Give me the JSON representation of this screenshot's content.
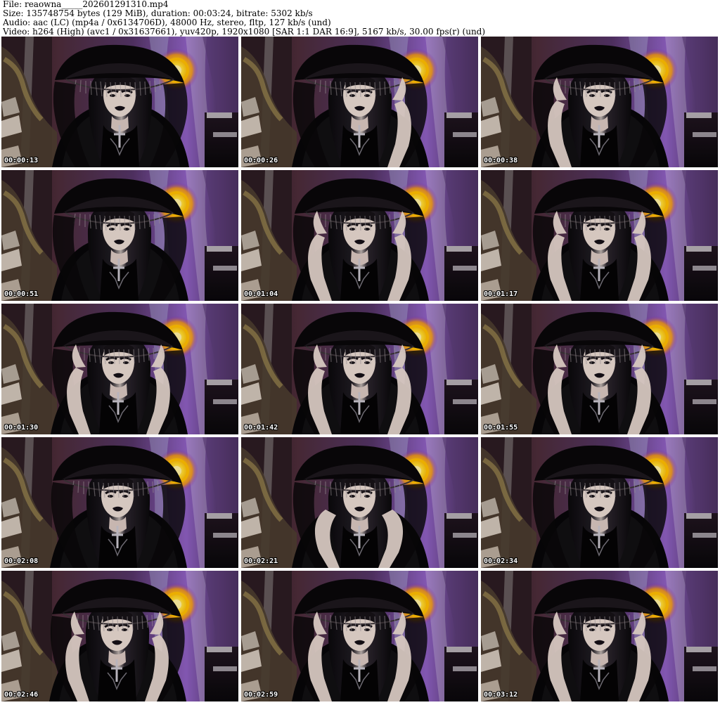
{
  "header": {
    "file_line": "File: reaowna_____202601291310.mp4",
    "size_line": "Size: 135748754 bytes (129 MiB), duration: 00:03:24, bitrate: 5302 kb/s",
    "audio_line": "Audio: aac (LC) (mp4a / 0x6134706D), 48000 Hz, stereo, fltp, 127 kb/s (und)",
    "video_line": "Video: h264 (High) (avc1 / 0x31637661), yuv420p, 1920x1080 [SAR 1:1 DAR 16:9], 5167 kb/s, 30.00 fps(r) (und)"
  },
  "thumbnails": [
    {
      "time": "00:00:13",
      "pose": "hat"
    },
    {
      "time": "00:00:26",
      "pose": "hand-right-hat"
    },
    {
      "time": "00:00:38",
      "pose": "hand-left-up"
    },
    {
      "time": "00:00:51",
      "pose": "hat"
    },
    {
      "time": "00:01:04",
      "pose": "hands-both-hat"
    },
    {
      "time": "00:01:17",
      "pose": "hands-both-side"
    },
    {
      "time": "00:01:30",
      "pose": "hands-both-hat"
    },
    {
      "time": "00:01:42",
      "pose": "hands-both-hat"
    },
    {
      "time": "00:01:55",
      "pose": "hands-both-hat"
    },
    {
      "time": "00:02:08",
      "pose": "hat"
    },
    {
      "time": "00:02:21",
      "pose": "hands-hair"
    },
    {
      "time": "00:02:34",
      "pose": "hat"
    },
    {
      "time": "00:02:46",
      "pose": "hands-both-hat"
    },
    {
      "time": "00:02:59",
      "pose": "hands-both-hat"
    },
    {
      "time": "00:03:12",
      "pose": "hands-both-hat"
    }
  ],
  "colors": {
    "background": "#ffffff",
    "frame_dark": "#130d16",
    "wall_purple": "#8d5fc0",
    "lamp_yellow": "#ffd21c",
    "skin": "#e8d8d0",
    "lipstick": "#151016"
  }
}
